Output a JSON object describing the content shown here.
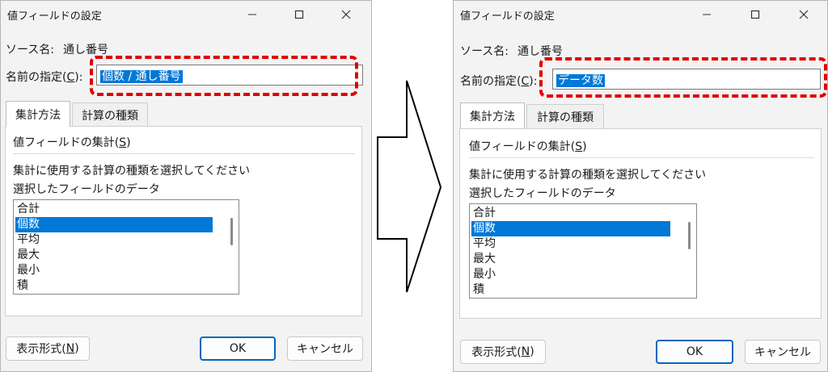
{
  "left_dialog": {
    "title": "値フィールドの設定",
    "source_label": "ソース名:",
    "source_value": "通し番号",
    "name_label_pre": "名前の指定(",
    "name_label_key": "C",
    "name_label_post": "):",
    "name_value": "個数 / 通し番号",
    "tabs": [
      "集計方法",
      "計算の種類"
    ],
    "section_pre": "値フィールドの集計(",
    "section_key": "S",
    "section_post": ")",
    "instruction_1": "集計に使用する計算の種類を選択してください",
    "instruction_2": "選択したフィールドのデータ",
    "list_items": [
      "合計",
      "個数",
      "平均",
      "最大",
      "最小",
      "積"
    ],
    "selected_item": "個数",
    "format_btn_pre": "表示形式(",
    "format_btn_key": "N",
    "format_btn_post": ")",
    "ok_label": "OK",
    "cancel_label": "キャンセル"
  },
  "right_dialog": {
    "title": "値フィールドの設定",
    "source_label": "ソース名:",
    "source_value": "通し番号",
    "name_label_pre": "名前の指定(",
    "name_label_key": "C",
    "name_label_post": "):",
    "name_value": "データ数",
    "tabs": [
      "集計方法",
      "計算の種類"
    ],
    "section_pre": "値フィールドの集計(",
    "section_key": "S",
    "section_post": ")",
    "instruction_1": "集計に使用する計算の種類を選択してください",
    "instruction_2": "選択したフィールドのデータ",
    "list_items": [
      "合計",
      "個数",
      "平均",
      "最大",
      "最小",
      "積"
    ],
    "selected_item": "個数",
    "format_btn_pre": "表示形式(",
    "format_btn_key": "N",
    "format_btn_post": ")",
    "ok_label": "OK",
    "cancel_label": "キャンセル"
  },
  "icons": {
    "minimize": "minimize-icon",
    "maximize": "maximize-icon",
    "close": "close-icon",
    "arrow": "right-arrow-icon"
  },
  "colors": {
    "highlight": "#e00000",
    "selection": "#0078d7",
    "dialog_bg": "#f3f3f3",
    "ok_border": "#0067c0"
  }
}
